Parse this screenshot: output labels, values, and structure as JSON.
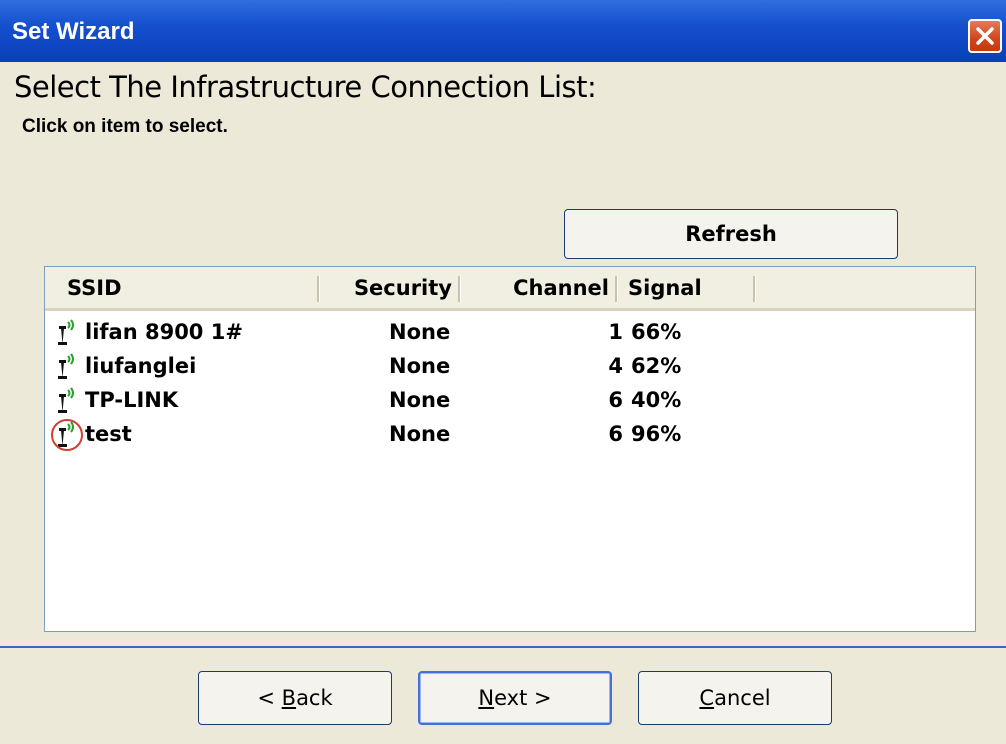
{
  "window": {
    "title": "Set Wizard"
  },
  "heading": "Select The Infrastructure Connection List:",
  "subheading": "Click on item to select.",
  "refresh_label": "Refresh",
  "columns": [
    "SSID",
    "Security",
    "Channel",
    "Signal"
  ],
  "networks": [
    {
      "ssid": "lifan 8900 1#",
      "security": "None",
      "channel": "1",
      "signal": "66%",
      "icon": "antenna-signal-icon",
      "highlighted": false
    },
    {
      "ssid": "liufanglei",
      "security": "None",
      "channel": "4",
      "signal": "62%",
      "icon": "antenna-signal-icon",
      "highlighted": false
    },
    {
      "ssid": "TP-LINK",
      "security": "None",
      "channel": "6",
      "signal": "40%",
      "icon": "antenna-signal-icon",
      "highlighted": false
    },
    {
      "ssid": "test",
      "security": "None",
      "channel": "6",
      "signal": "96%",
      "icon": "antenna-signal-icon",
      "highlighted": true
    }
  ],
  "buttons": {
    "back": {
      "prefix": "< ",
      "accel": "B",
      "rest": "ack"
    },
    "next": {
      "accel": "N",
      "rest": "ext",
      "suffix": " >"
    },
    "cancel": {
      "accel": "C",
      "rest": "ancel"
    }
  },
  "colors": {
    "titlebar": "#0b3fb4",
    "dialog_bg": "#ece9d8",
    "signal_green": "#2aa12a",
    "highlight_ring": "#d04030"
  }
}
